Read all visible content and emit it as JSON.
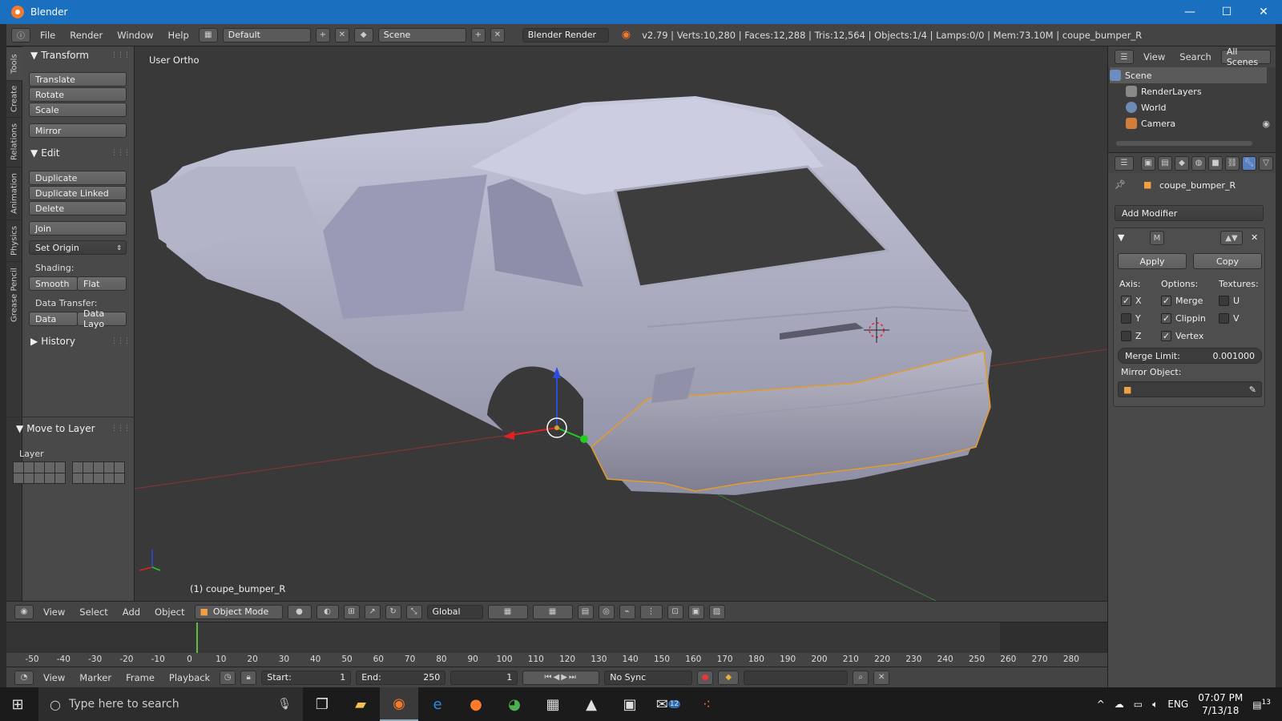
{
  "window": {
    "title": "Blender",
    "minimize": "—",
    "maximize": "☐",
    "close": "✕"
  },
  "info_header": {
    "menus": [
      "File",
      "Render",
      "Window",
      "Help"
    ],
    "layout": "Default",
    "scene": "Scene",
    "engine": "Blender Render",
    "stats": "v2.79 | Verts:10,280 | Faces:12,288 | Tris:12,564 | Objects:1/4 | Lamps:0/0 | Mem:73.10M | coupe_bumper_R"
  },
  "tool_tabs": [
    "Tools",
    "Create",
    "Relations",
    "Animation",
    "Physics",
    "Grease Pencil"
  ],
  "tool_shelf": {
    "transform_title": "Transform",
    "translate": "Translate",
    "rotate": "Rotate",
    "scale": "Scale",
    "mirror": "Mirror",
    "edit_title": "Edit",
    "duplicate": "Duplicate",
    "duplicate_linked": "Duplicate Linked",
    "delete": "Delete",
    "join": "Join",
    "set_origin": "Set Origin",
    "shading_label": "Shading:",
    "smooth": "Smooth",
    "flat": "Flat",
    "data_transfer_label": "Data Transfer:",
    "data": "Data",
    "data_layo": "Data Layo",
    "history_title": "History",
    "move_to_layer_title": "Move to Layer",
    "layer_label": "Layer"
  },
  "viewport": {
    "view_label": "User Ortho",
    "object_label": "(1) coupe_bumper_R"
  },
  "view3d_header": {
    "menus": [
      "View",
      "Select",
      "Add",
      "Object"
    ],
    "mode": "Object Mode",
    "orientation": "Global"
  },
  "timeline": {
    "ticks": [
      "-50",
      "-40",
      "-30",
      "-20",
      "-10",
      "0",
      "10",
      "20",
      "30",
      "40",
      "50",
      "60",
      "70",
      "80",
      "90",
      "100",
      "110",
      "120",
      "130",
      "140",
      "150",
      "160",
      "170",
      "180",
      "190",
      "200",
      "210",
      "220",
      "230",
      "240",
      "250",
      "260",
      "270",
      "280"
    ],
    "menus": [
      "View",
      "Marker",
      "Frame",
      "Playback"
    ],
    "start_label": "Start:",
    "start_value": "1",
    "end_label": "End:",
    "end_value": "250",
    "current_frame": "1",
    "sync": "No Sync"
  },
  "outliner": {
    "menus": [
      "View",
      "Search"
    ],
    "filter": "All Scenes",
    "rows": [
      "Scene",
      "RenderLayers",
      "World",
      "Camera"
    ]
  },
  "properties": {
    "object_name": "coupe_bumper_R",
    "add_modifier": "Add Modifier",
    "apply": "Apply",
    "copy": "Copy",
    "axis_label": "Axis:",
    "options_label": "Options:",
    "textures_label": "Textures:",
    "x": "X",
    "y": "Y",
    "z": "Z",
    "merge": "Merge",
    "clipping": "Clippin",
    "vertex": "Vertex",
    "u": "U",
    "v": "V",
    "merge_limit_label": "Merge Limit:",
    "merge_limit_value": "0.001000",
    "mirror_object_label": "Mirror Object:",
    "modifier_m": "M"
  },
  "taskbar": {
    "search_placeholder": "Type here to search",
    "lang": "ENG",
    "time": "07:07 PM",
    "date": "7/13/18",
    "notif_count": "13",
    "mail_count": "12"
  }
}
